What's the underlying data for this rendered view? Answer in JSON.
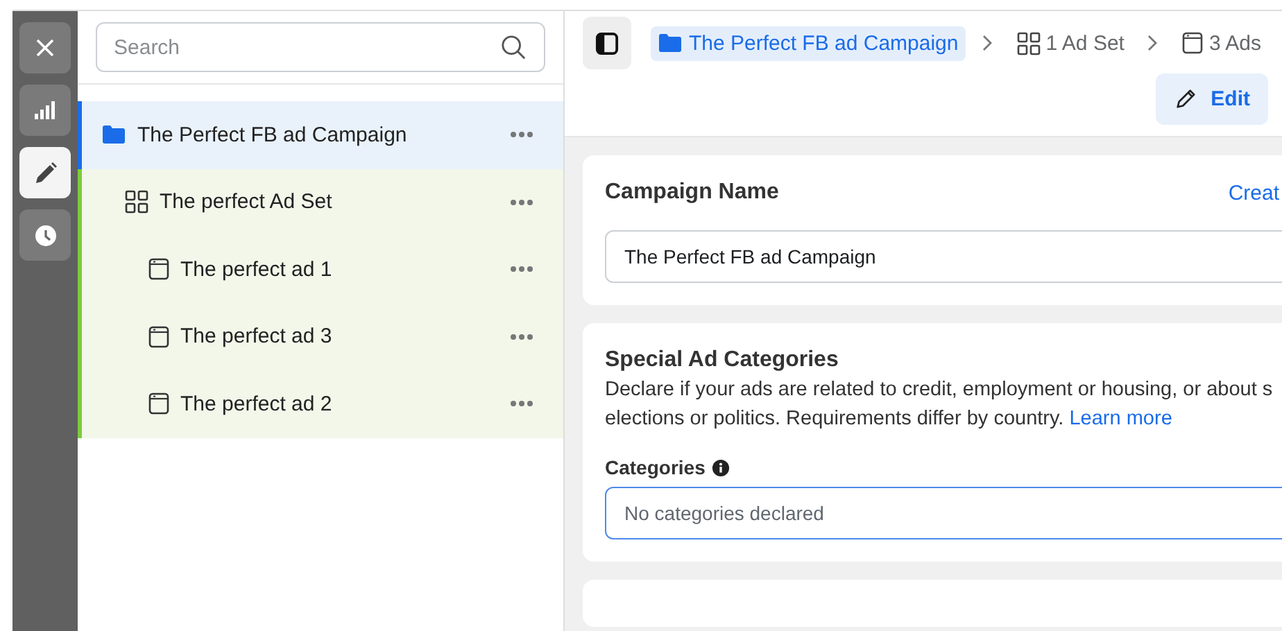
{
  "rail": [
    {
      "kind": "close",
      "selected": false
    },
    {
      "kind": "chart",
      "selected": false
    },
    {
      "kind": "edit",
      "selected": true
    },
    {
      "kind": "history",
      "selected": false
    }
  ],
  "search": {
    "placeholder": "Search"
  },
  "tree": [
    {
      "kind": "campaign",
      "label": "The Perfect FB ad Campaign",
      "selected": true,
      "children": [
        {
          "kind": "adset",
          "label": "The perfect Ad Set",
          "selected": false,
          "children": [
            {
              "kind": "ad",
              "label": "The perfect ad 1",
              "selected": false
            },
            {
              "kind": "ad",
              "label": "The perfect ad 3",
              "selected": false
            },
            {
              "kind": "ad",
              "label": "The perfect ad 2",
              "selected": false
            }
          ]
        }
      ]
    }
  ],
  "breadcrumb": [
    {
      "kind": "campaign",
      "label": "The Perfect FB ad Campaign",
      "selected": true
    },
    {
      "kind": "adset",
      "label": "1 Ad Set",
      "selected": false
    },
    {
      "kind": "ad",
      "label": "3 Ads",
      "selected": false
    }
  ],
  "edit_button": "Edit",
  "campaign_card": {
    "title": "Campaign Name",
    "action": "Creat",
    "value": "The Perfect FB ad Campaign"
  },
  "special_card": {
    "title": "Special Ad Categories",
    "description_lines": [
      "Declare if your ads are related to credit, employment or housing, or about s",
      "elections or politics. Requirements differ by country."
    ],
    "link": "Learn more",
    "field_label": "Categories",
    "placeholder": "No categories declared"
  }
}
